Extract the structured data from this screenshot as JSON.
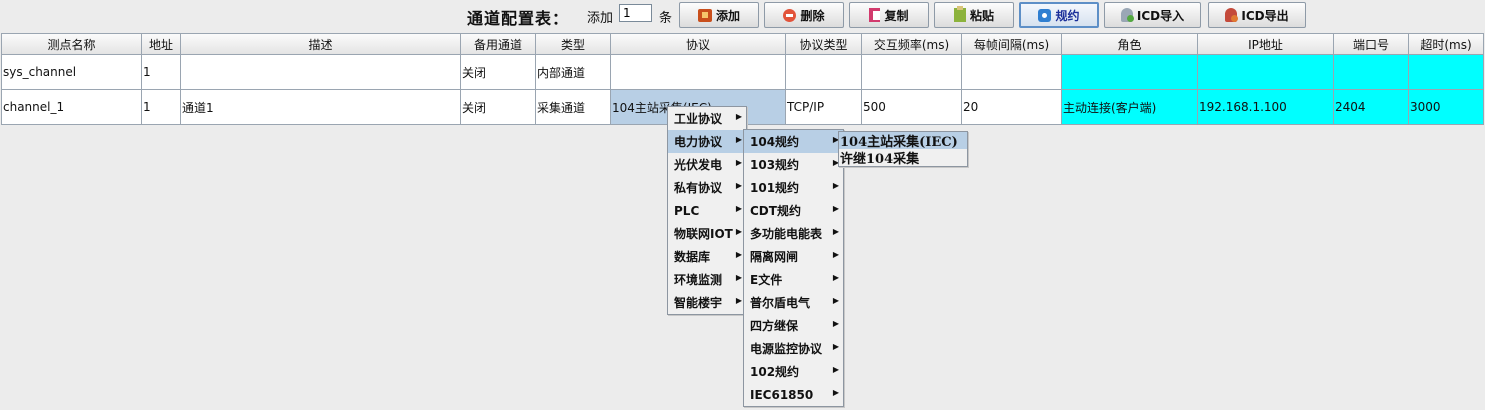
{
  "toolbar": {
    "title": "通道配置表：",
    "add_prefix": "添加",
    "add_count": "1",
    "add_suffix": "条",
    "buttons": {
      "add": "添加",
      "delete": "删除",
      "copy": "复制",
      "paste": "粘贴",
      "rule": "规约",
      "icd_import": "ICD导入",
      "icd_export": "ICD导出"
    }
  },
  "table": {
    "headers": [
      "测点名称",
      "地址",
      "描述",
      "备用通道",
      "类型",
      "协议",
      "协议类型",
      "交互频率(ms)",
      "每帧间隔(ms)",
      "角色",
      "IP地址",
      "端口号",
      "超时(ms)"
    ],
    "rows": [
      [
        "sys_channel",
        "1",
        "",
        "关闭",
        "内部通道",
        "",
        "",
        "",
        "",
        "",
        "",
        "",
        ""
      ],
      [
        "channel_1",
        "1",
        "通道1",
        "关闭",
        "采集通道",
        "104主站采集(IEC)",
        "TCP/IP",
        "500",
        "20",
        "主动连接(客户端)",
        "192.168.1.100",
        "2404",
        "3000"
      ]
    ]
  },
  "menu_protocols": {
    "items": [
      "工业协议",
      "电力协议",
      "光伏发电",
      "私有协议",
      "PLC",
      "物联网IOT",
      "数据库",
      "环境监测",
      "智能楼宇"
    ],
    "highlighted_index": 1
  },
  "menu_power": {
    "items": [
      "104规约",
      "103规约",
      "101规约",
      "CDT规约",
      "多功能电能表",
      "隔离网闸",
      "E文件",
      "普尔盾电气",
      "四方继保",
      "电源监控协议",
      "102规约",
      "IEC61850"
    ],
    "highlighted_index": 0
  },
  "menu_104": {
    "items": [
      "104主站采集(IEC)",
      "许继104采集"
    ],
    "highlighted_index": 0
  },
  "colors": {
    "cyan_cell": "#00ffff",
    "selection": "#b8cfe5",
    "active_button_text": "#1b2f9a"
  }
}
